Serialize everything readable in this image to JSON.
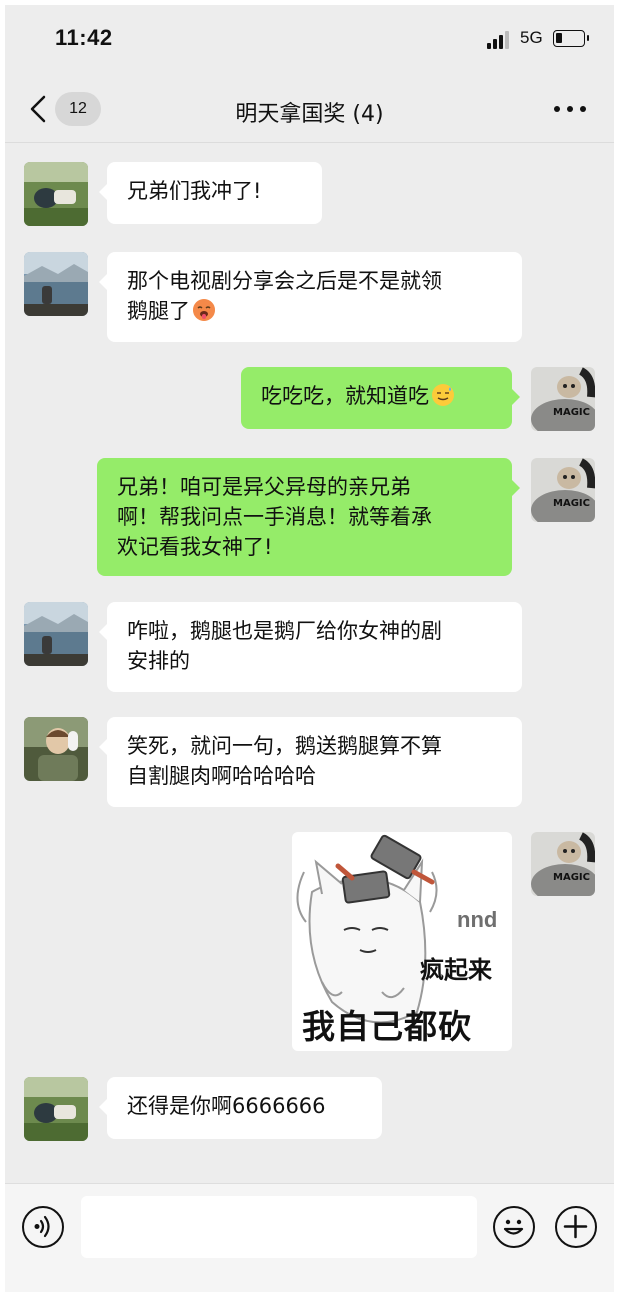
{
  "status_bar": {
    "time": "11:42",
    "network": "5G"
  },
  "nav": {
    "unread_count": "12",
    "title": "明天拿国奖 (4)"
  },
  "messages": [
    {
      "direction": "in",
      "text": "兄弟们我冲了!"
    },
    {
      "direction": "in",
      "text_line1": "那个电视剧分享会之后是不是就领",
      "text_line2": "鹅腿了",
      "emoji": "hot-face-emoji"
    },
    {
      "direction": "out",
      "text": "吃吃吃，就知道吃",
      "emoji": "sweat-smile-emoji"
    },
    {
      "direction": "out",
      "text_line1": "兄弟！咱可是异父异母的亲兄弟",
      "text_line2": "啊！帮我问点一手消息！就等着承",
      "text_line3": "欢记看我女神了!"
    },
    {
      "direction": "in",
      "text_line1": "咋啦，鹅腿也是鹅厂给你女神的剧",
      "text_line2": "安排的"
    },
    {
      "direction": "in",
      "text_line1": "笑死，就问一句，鹅送鹅腿算不算",
      "text_line2": "自割腿肉啊哈哈哈哈"
    },
    {
      "direction": "out",
      "type": "sticker",
      "sticker_text_small": "nnd",
      "sticker_text_mid": "疯起来",
      "sticker_text_big": "我自己都砍"
    },
    {
      "direction": "in",
      "text": "还得是你啊6666666"
    }
  ],
  "input_bar": {
    "voice_icon": "voice-icon",
    "emoji_icon": "emoji-icon",
    "plus_icon": "plus-icon",
    "placeholder": ""
  },
  "colors": {
    "background": "#ededed",
    "incoming_bubble": "#ffffff",
    "outgoing_bubble": "#95ec69"
  }
}
